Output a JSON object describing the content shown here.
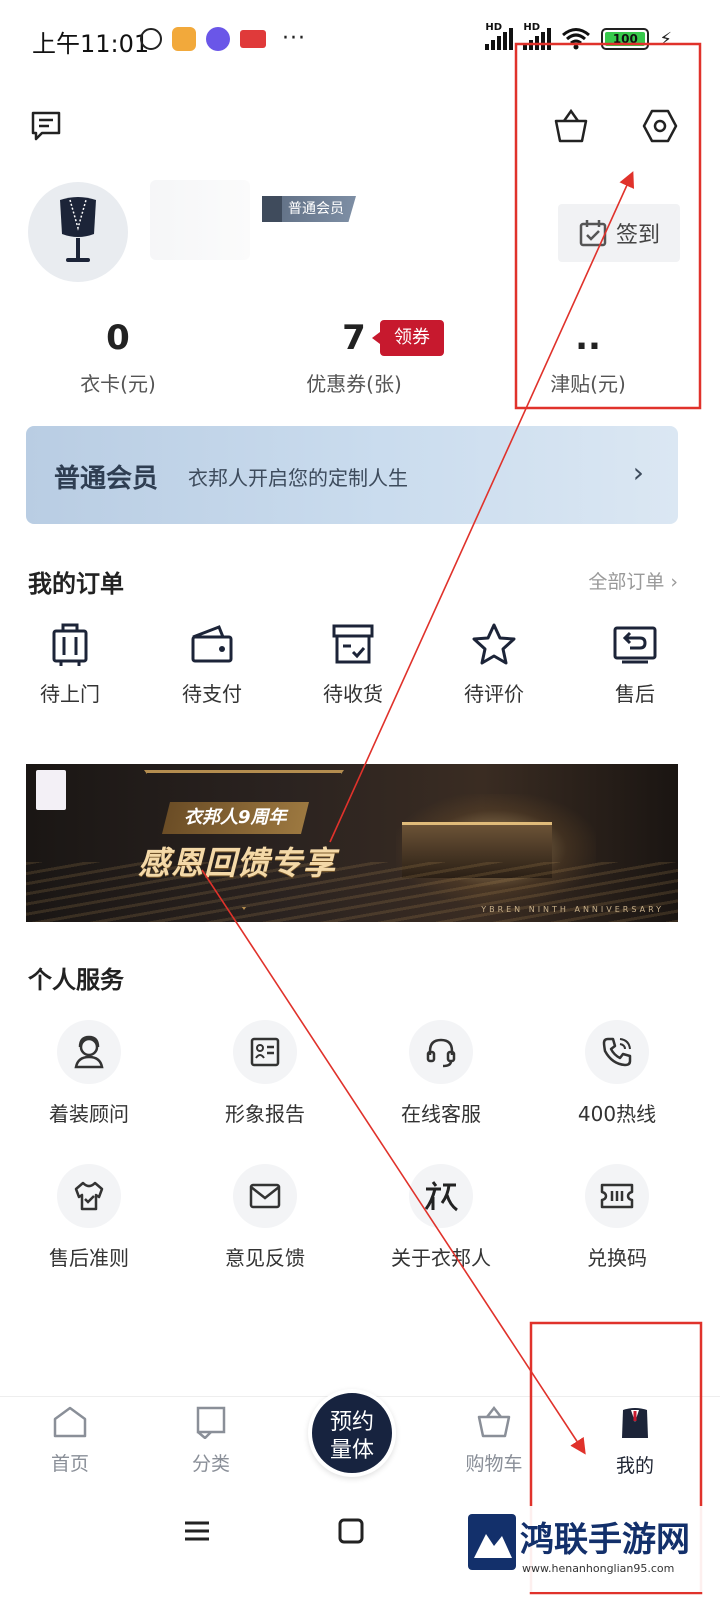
{
  "status_bar": {
    "time": "上午11:01",
    "signal1_hd": "HD",
    "signal2_hd": "HD",
    "battery": "100",
    "more": "···"
  },
  "profile": {
    "member_tag": "普通会员",
    "checkin_label": "签到"
  },
  "stats": [
    {
      "value": "0",
      "label": "衣卡(元)"
    },
    {
      "value": "7",
      "label": "优惠券(张)"
    },
    {
      "value": "..",
      "label": "津贴(元)"
    }
  ],
  "coupon_badge": "领券",
  "member_banner": {
    "title": "普通会员",
    "subtitle": "衣邦人开启您的定制人生",
    "chevron": "›"
  },
  "orders": {
    "title": "我的订单",
    "all_link": "全部订单 ›",
    "items": [
      {
        "label": "待上门",
        "icon": "suitcase-icon"
      },
      {
        "label": "待支付",
        "icon": "wallet-icon"
      },
      {
        "label": "待收货",
        "icon": "package-icon"
      },
      {
        "label": "待评价",
        "icon": "star-icon"
      },
      {
        "label": "售后",
        "icon": "return-icon"
      }
    ]
  },
  "promo": {
    "anniversary": "衣邦人9周年",
    "headline": "感恩回馈专享",
    "english": "YBREN NINTH ANNIVERSARY"
  },
  "services": {
    "title": "个人服务",
    "items": [
      {
        "label": "着装顾问",
        "icon": "advisor-icon"
      },
      {
        "label": "形象报告",
        "icon": "report-icon"
      },
      {
        "label": "在线客服",
        "icon": "headset-icon"
      },
      {
        "label": "400热线",
        "icon": "phone-icon"
      },
      {
        "label": "售后准则",
        "icon": "shirt-icon"
      },
      {
        "label": "意见反馈",
        "icon": "mail-icon"
      },
      {
        "label": "关于衣邦人",
        "icon": "brand-icon"
      },
      {
        "label": "兑换码",
        "icon": "ticket-icon"
      }
    ]
  },
  "bottom_nav": {
    "home": "首页",
    "category": "分类",
    "center_line1": "预约",
    "center_line2": "量体",
    "cart": "购物车",
    "mine": "我的"
  },
  "watermark": {
    "brand": "鸿联手游网",
    "url": "www.henanhonglian95.com"
  },
  "colors": {
    "accent_navy": "#17233f",
    "coupon_red": "#c7192e",
    "annotation_red": "#e0322b"
  }
}
